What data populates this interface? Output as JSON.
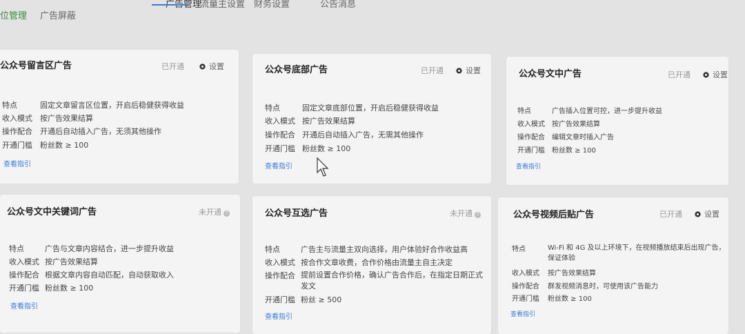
{
  "topnav": {
    "items": [
      "广告管理",
      "流量主设置",
      "财务设置",
      "公告消息"
    ]
  },
  "subnav": {
    "items": [
      "位管理",
      "广告屏蔽"
    ]
  },
  "common": {
    "features": "特点",
    "income": "收入模式",
    "operation": "操作配合",
    "threshold": "开通门槛",
    "guide": "查看指引",
    "settings": "设置"
  },
  "cards": [
    {
      "title": "公众号留言区广告",
      "status": "已开通",
      "features": "固定文章留言区位置，开启后稳健获得收益",
      "income": "按广告效果结算",
      "operation": "开通后自动插入广告，无须其他操作",
      "threshold": "粉丝数 ≥ 100"
    },
    {
      "title": "公众号底部广告",
      "status": "已开通",
      "features": "固定文章底部位置，开启后稳健获得收益",
      "income": "按广告效果结算",
      "operation": "开通后自动插入广告，无需其他操作",
      "threshold": "粉丝数 ≥ 100"
    },
    {
      "title": "公众号文中广告",
      "status": "已开通",
      "features": "广告插入位置可控，进一步提升收益",
      "income": "按广告效果结算",
      "operation": "编辑文章时插入广告",
      "threshold": "粉丝数 ≥ 100"
    },
    {
      "title": "公众号文中关键词广告",
      "status": "未开通",
      "features": "广告与文章内容结合，进一步提升收益",
      "income": "按广告效果结算",
      "operation": "根据文章内容自动匹配，自动获取收入",
      "threshold": "粉丝数 ≥ 100"
    },
    {
      "title": "公众号互选广告",
      "status": "未开通",
      "features": "广告主与流量主双向选择，用户体验好合作收益高",
      "income": "按合作文章收费，合作价格由流量主自主决定",
      "operation_line1": "提前设置合作价格，确认广告合作后，在指定日期正式",
      "operation_line2": "发文",
      "threshold": "粉丝 ≥ 500"
    },
    {
      "title": "公众号视频后贴广告",
      "status": "已开通",
      "features_line1": "Wi-Fi 和 4G 及以上环境下，在视频播放结束后出现广告，",
      "features_line2": "保证体验",
      "income": "按广告效果结算",
      "operation": "群发视频消息时，可使用该广告能力",
      "threshold": "粉丝数 ≥ 100"
    }
  ]
}
